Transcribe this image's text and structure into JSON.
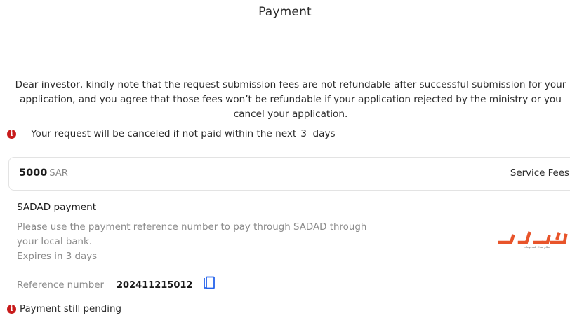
{
  "header": {
    "title": "Payment"
  },
  "notice": {
    "text": "Dear investor, kindly note that the request submission fees are not refundable after successful submission for your application, and you agree that those fees won’t be refundable if your application rejected by the ministry or you cancel your application."
  },
  "warning": {
    "icon": "info-icon",
    "text": "Your request will be canceled if not paid within the next",
    "days": "3  days"
  },
  "fee": {
    "amount": "5000",
    "currency": "SAR",
    "label": "Service Fees"
  },
  "sadad": {
    "title": "SADAD payment",
    "description": "Please use the payment reference number to pay through SADAD through your local bank.",
    "expiry": "Expires in 3 days",
    "logo_text": "سداد",
    "logo_caption": "نظام سداد للمدفوعات",
    "logo_color": "#e8542a"
  },
  "reference": {
    "label": "Reference number",
    "value": "202411215012",
    "copy_icon": "copy-icon",
    "icon_color": "#2563eb"
  },
  "status": {
    "icon": "info-icon",
    "text": "Payment still pending",
    "color": "#c81b1b"
  }
}
